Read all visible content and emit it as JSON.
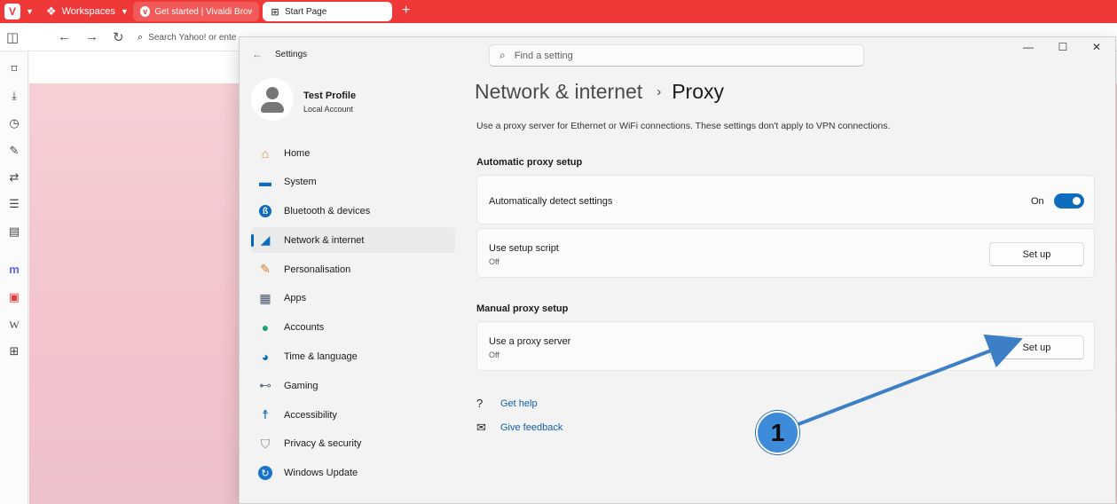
{
  "browser": {
    "logo": "V",
    "workspaces_label": "Workspaces",
    "tabs": [
      {
        "label": "Get started | Vivaldi Browser",
        "icon": "vivaldi-icon"
      },
      {
        "label": "Start Page",
        "icon": "grid-icon"
      }
    ],
    "address_placeholder": "Search Yahoo! or enter"
  },
  "settings": {
    "app_title": "Settings",
    "search_placeholder": "Find a setting",
    "profile": {
      "name": "Test Profile",
      "account": "Local Account"
    },
    "nav": [
      {
        "label": "Home",
        "icon": "home-icon"
      },
      {
        "label": "System",
        "icon": "monitor-icon"
      },
      {
        "label": "Bluetooth & devices",
        "icon": "bluetooth-icon"
      },
      {
        "label": "Network & internet",
        "icon": "wifi-icon"
      },
      {
        "label": "Personalisation",
        "icon": "brush-icon"
      },
      {
        "label": "Apps",
        "icon": "apps-icon"
      },
      {
        "label": "Accounts",
        "icon": "person-icon"
      },
      {
        "label": "Time & language",
        "icon": "globe-clock-icon"
      },
      {
        "label": "Gaming",
        "icon": "gamepad-icon"
      },
      {
        "label": "Accessibility",
        "icon": "accessibility-icon"
      },
      {
        "label": "Privacy & security",
        "icon": "shield-icon"
      },
      {
        "label": "Windows Update",
        "icon": "update-icon"
      }
    ],
    "selected_nav": "Network & internet",
    "breadcrumb": {
      "parent": "Network & internet",
      "separator": "›",
      "current": "Proxy"
    },
    "description": "Use a proxy server for Ethernet or WiFi connections. These settings don't apply to VPN connections.",
    "automatic": {
      "section_title": "Automatic proxy setup",
      "detect": {
        "title": "Automatically detect settings",
        "toggle_label": "On",
        "toggle_on": true
      },
      "script": {
        "title": "Use setup script",
        "status": "Off",
        "button": "Set up"
      }
    },
    "manual": {
      "section_title": "Manual proxy setup",
      "proxy": {
        "title": "Use a proxy server",
        "status": "Off",
        "button": "Set up"
      }
    },
    "links": {
      "help": "Get help",
      "feedback": "Give feedback"
    }
  },
  "annotation": {
    "step_number": "1",
    "color": "#3d7fc7"
  },
  "colors": {
    "vivaldi_red": "#ef3939",
    "accent": "#0f6cbd"
  }
}
